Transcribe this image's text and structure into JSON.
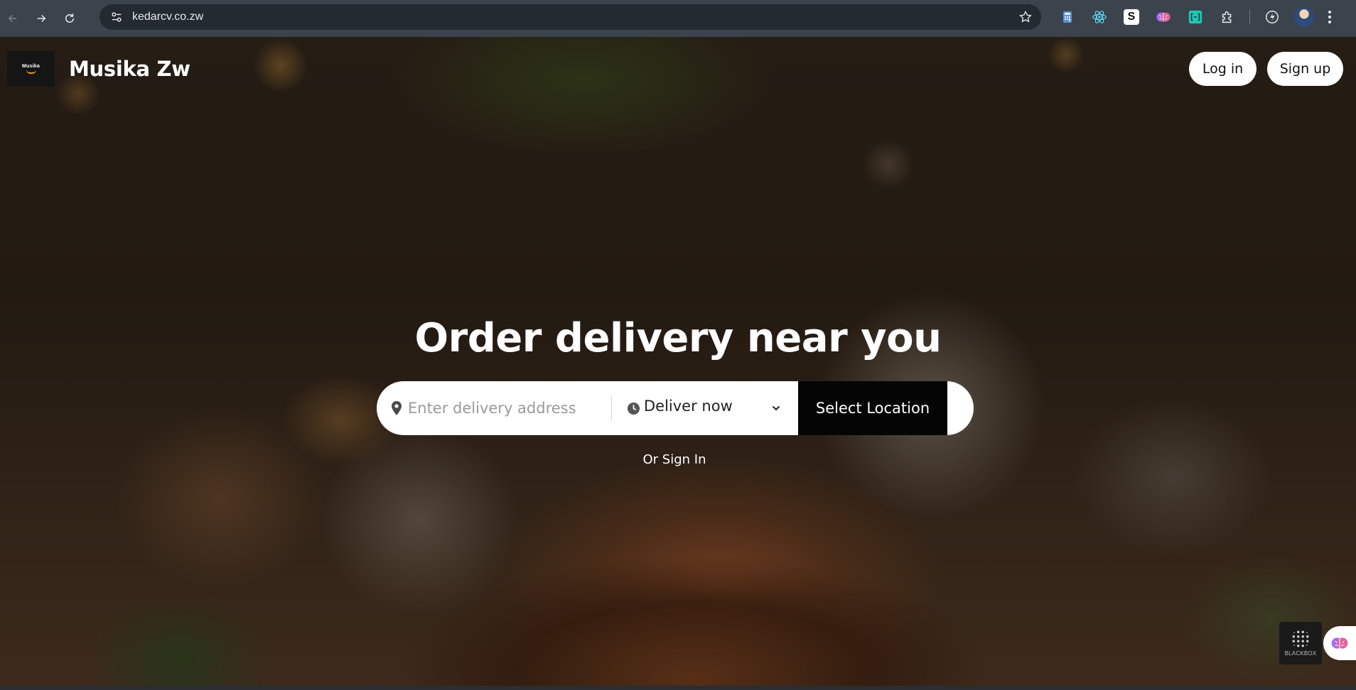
{
  "browser": {
    "url": "kedarcv.co.zw",
    "extensions": [
      {
        "name": "calculator-extension-icon",
        "color": "#5b8fd6"
      },
      {
        "name": "react-devtools-extension-icon",
        "color": "#61dafb"
      },
      {
        "name": "s-extension-icon",
        "label": "S",
        "color": "#ffffff"
      },
      {
        "name": "brain-extension-icon",
        "color": "#a56cf0"
      },
      {
        "name": "bracket-extension-icon",
        "color": "#1fc9b5"
      },
      {
        "name": "puzzle-extensions-icon",
        "color": "#e8eaed"
      }
    ]
  },
  "header": {
    "logo_text": "Musika",
    "brand": "Musika Zw",
    "login_label": "Log in",
    "signup_label": "Sign up"
  },
  "hero": {
    "title": "Order delivery near you",
    "address_placeholder": "Enter delivery address",
    "deliver_label": "Deliver now",
    "select_location_label": "Select Location",
    "or_sign_in": "Or Sign In"
  },
  "widgets": {
    "blackbox_label": "BLACKBOX"
  },
  "colors": {
    "chrome_bg": "#3b434d",
    "omnibox_bg": "#242a31",
    "button_black": "#050505",
    "accent_orange": "#f39c12"
  }
}
